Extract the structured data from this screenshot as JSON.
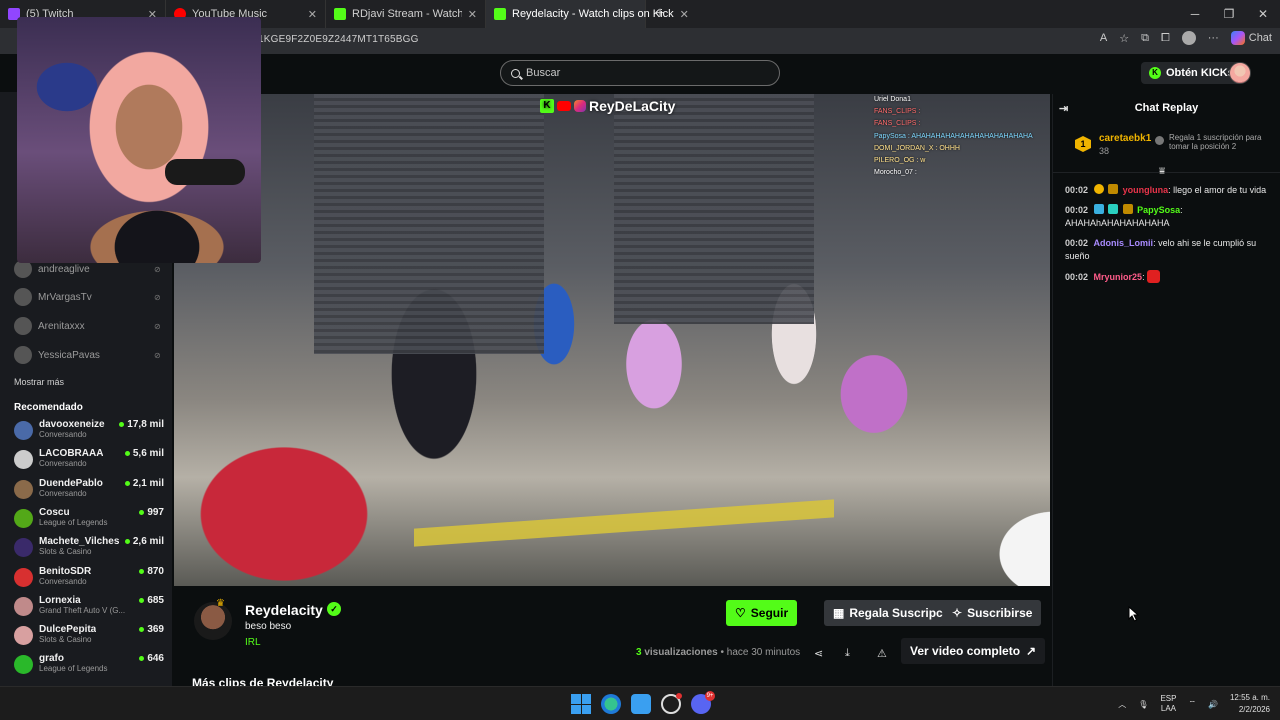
{
  "browser": {
    "tabs": [
      {
        "label": "(5) Twitch",
        "favicon_color": "#9146ff",
        "active": false
      },
      {
        "label": "YouTube Music",
        "favicon_color": "#ff0000",
        "active": false
      },
      {
        "label": "RDjavi Stream - Watch Live on Kick",
        "favicon_color": "#53fc18",
        "active": false
      },
      {
        "label": "Reydelacity - Watch clips on Kick",
        "favicon_color": "#53fc18",
        "active": true
      }
    ],
    "new_tab": "+",
    "url_fragment": "1KGE9F2Z0E9Z2447MT1T65BGG",
    "copilot_label": "Chat"
  },
  "header": {
    "search_placeholder": "Buscar",
    "kicks_button": "Obtén KICKs"
  },
  "sidebar": {
    "followed": [
      {
        "name": "andreaglive"
      },
      {
        "name": "MrVargasTv"
      },
      {
        "name": "Arenitaxxx"
      },
      {
        "name": "YessicaPavas"
      }
    ],
    "show_more": "Mostrar más",
    "recommended_title": "Recomendado",
    "recommended": [
      {
        "name": "davooxeneize",
        "category": "Conversando",
        "viewers": "17,8 mil",
        "color": "#4a6aa8"
      },
      {
        "name": "LACOBRAAA",
        "category": "Conversando",
        "viewers": "5,6 mil",
        "color": "#cccccc"
      },
      {
        "name": "DuendePablo",
        "category": "Conversando",
        "viewers": "2,1 mil",
        "color": "#8a6a4a"
      },
      {
        "name": "Coscu",
        "category": "League of Legends",
        "viewers": "997",
        "color": "#53a818"
      },
      {
        "name": "Machete_Vilches",
        "category": "Slots & Casino",
        "viewers": "2,6 mil",
        "color": "#3a2a6a"
      },
      {
        "name": "BenitoSDR",
        "category": "Conversando",
        "viewers": "870",
        "color": "#d83030"
      },
      {
        "name": "Lornexia",
        "category": "Grand Theft Auto V (G...",
        "viewers": "685",
        "color": "#c08a8a"
      },
      {
        "name": "DulcePepita",
        "category": "Slots & Casino",
        "viewers": "369",
        "color": "#d8a0a0"
      },
      {
        "name": "grafo",
        "category": "League of Legends",
        "viewers": "646",
        "color": "#2ab82a"
      }
    ]
  },
  "video": {
    "watermark": "ReyDeLaCity",
    "overlay_chat": [
      "Uriel Dona1",
      "FANS_CLIPS :",
      "FANS_CLIPS :",
      "PapySosa : AHAHAHAHAHAHAHAHAHAHAHAHA",
      "DOMI_JORDAN_X : OHHH",
      "PILERO_OG : w",
      "Morocho_07 :"
    ]
  },
  "clip": {
    "channel": "Reydelacity",
    "title": "beso beso",
    "category": "IRL",
    "follow_label": "Seguir",
    "gift_label": "Regala Suscripciones",
    "subscribe_label": "Suscribirse",
    "views_count": "3",
    "views_label": "visualizaciones",
    "time_ago": "hace 30 minutos",
    "full_video_label": "Ver video completo",
    "more_clips": "Más clips de Reydelacity"
  },
  "chat": {
    "title": "Chat Replay",
    "leader": {
      "rank": "1",
      "name": "caretaebk1",
      "count": "38",
      "text": "Regala 1 suscripción para tomar la posición 2"
    },
    "messages": [
      {
        "time": "00:02",
        "user": "youngluna",
        "user_color": "#e8344a",
        "text": ": llego el amor de tu vida"
      },
      {
        "time": "00:02",
        "user": "PapySosa",
        "user_color": "#53fc18",
        "text": ": AHAHAhAHAHAHAHAHA"
      },
      {
        "time": "00:02",
        "user": "Adonis_Lomii",
        "user_color": "#a98bff",
        "text": ": velo ahi se le cumplió su sueño"
      },
      {
        "time": "00:02",
        "user": "Mryunior25",
        "user_color": "#ff5c8a",
        "text": ":"
      }
    ]
  },
  "taskbar": {
    "lang_top": "ESP",
    "lang_bottom": "LAA",
    "time": "12:55 a. m.",
    "date": "2/2/2026",
    "discord_badge": "9+"
  }
}
